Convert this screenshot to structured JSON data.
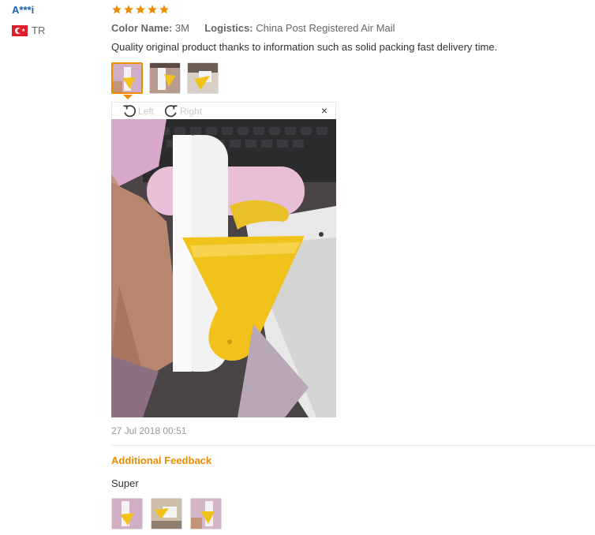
{
  "review": {
    "user": "A***i",
    "country_code": "TR",
    "rating": 5,
    "color_label": "Color Name:",
    "color_value": "3M",
    "logistics_label": "Logistics:",
    "logistics_value": "China Post Registered Air Mail",
    "comment": "Quality original product thanks to information such as solid packing fast delivery time.",
    "thumbnails_count": 3,
    "viewer": {
      "rotate_left": "Left",
      "rotate_right": "Right",
      "close": "×"
    },
    "date": "27 Jul 2018 00:51"
  },
  "additional": {
    "heading": "Additional Feedback",
    "comment": "Super",
    "thumbnails_count": 3
  },
  "colors": {
    "accent": "#f08c00",
    "user_link": "#1a5fb4",
    "muted": "#999999"
  }
}
